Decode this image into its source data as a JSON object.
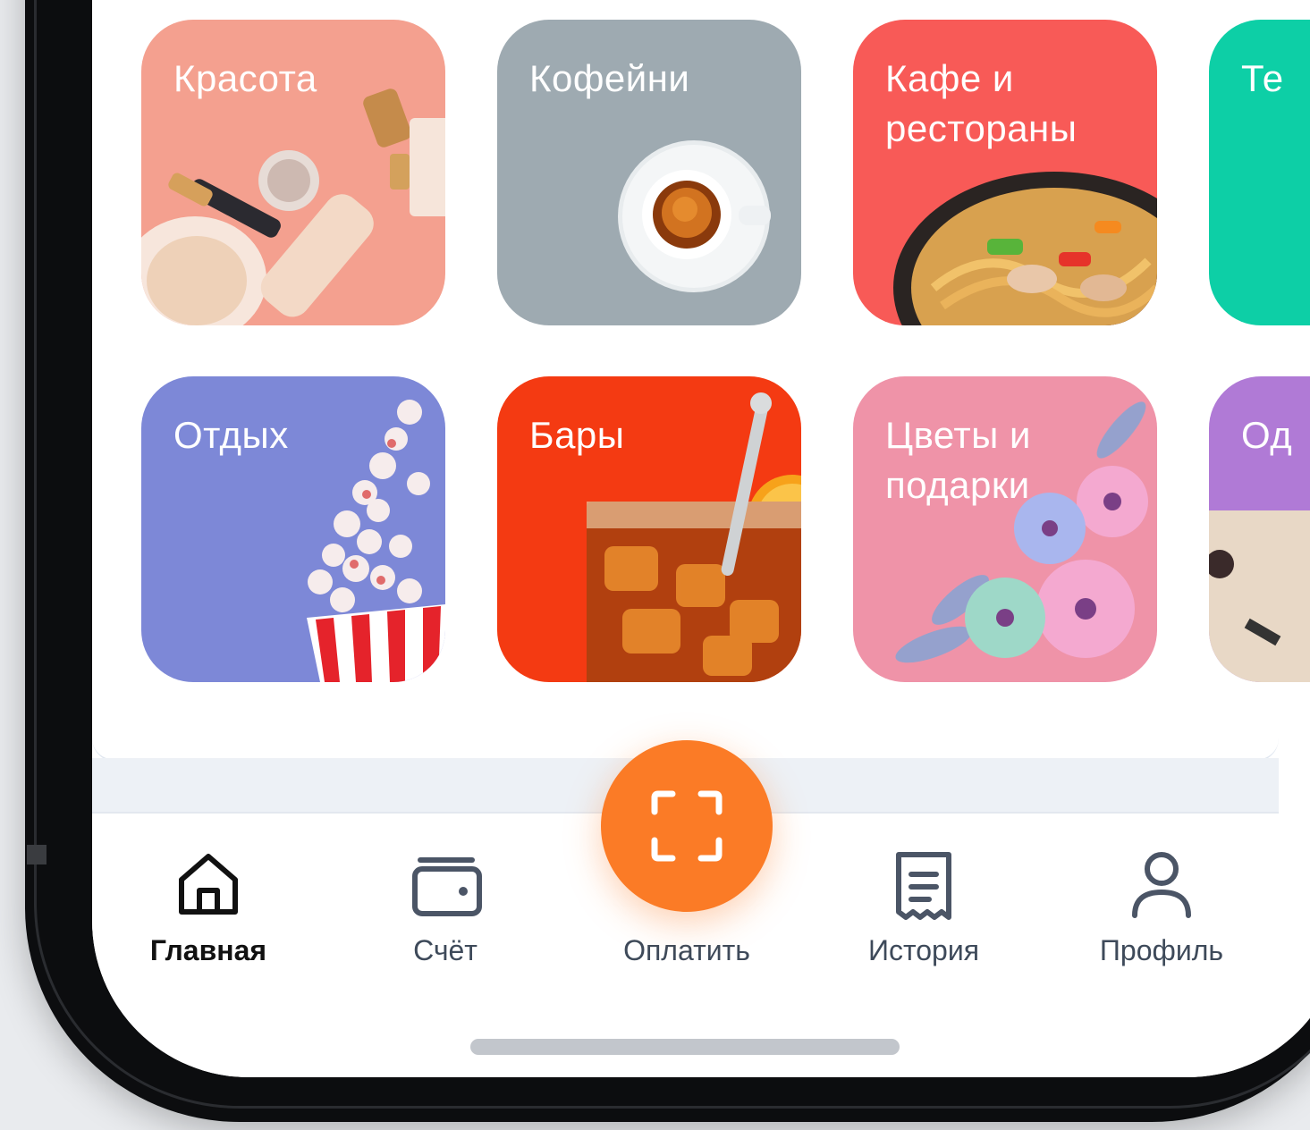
{
  "categories_row1": [
    {
      "label": "Красота",
      "color": "#f4a08f"
    },
    {
      "label": "Кофейни",
      "color": "#9eaab1"
    },
    {
      "label": "Кафе и рестораны",
      "color": "#f85a57"
    },
    {
      "label": "Те",
      "color": "#0dcfa6"
    }
  ],
  "categories_row2": [
    {
      "label": "Отдых",
      "color": "#7d88d7"
    },
    {
      "label": "Бары",
      "color": "#f43a12"
    },
    {
      "label": "Цветы и подарки",
      "color": "#ef93a8"
    },
    {
      "label": "Од",
      "color": "#b07ad6"
    }
  ],
  "nav": {
    "home": {
      "label": "Главная",
      "icon": "home-icon"
    },
    "account": {
      "label": "Счёт",
      "icon": "wallet-icon"
    },
    "pay": {
      "label": "Оплатить",
      "icon": "scan-icon"
    },
    "history": {
      "label": "История",
      "icon": "receipt-icon"
    },
    "profile": {
      "label": "Профиль",
      "icon": "person-icon"
    }
  },
  "colors": {
    "accent": "#fb7b26",
    "nav_text": "#3e4a5a",
    "nav_active": "#111111"
  }
}
